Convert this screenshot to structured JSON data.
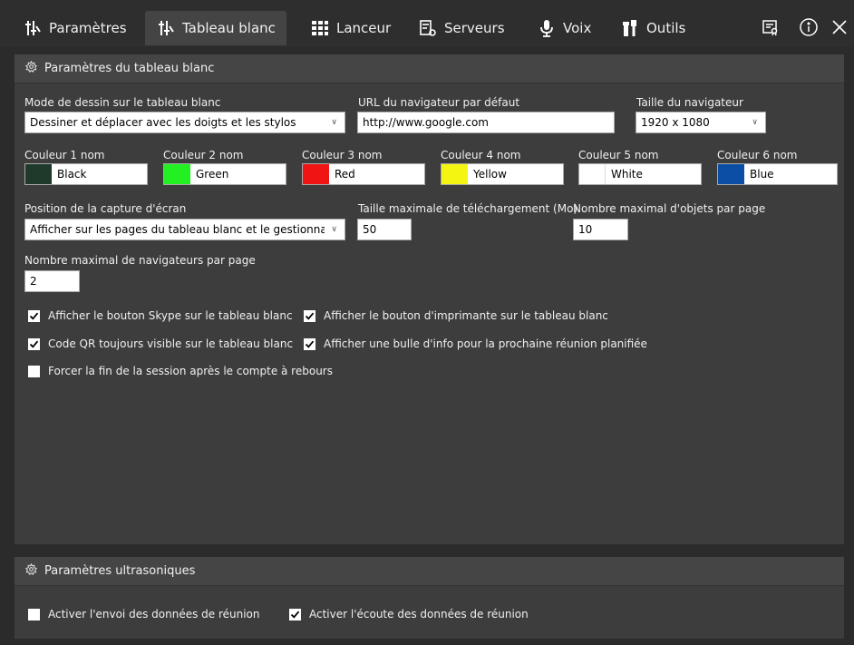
{
  "tabs": [
    {
      "label": "Paramètres",
      "icon": "settings-sliders-icon",
      "active": false
    },
    {
      "label": "Tableau blanc",
      "icon": "whiteboard-sliders-icon",
      "active": true
    },
    {
      "label": "Lanceur",
      "icon": "grid-icon",
      "active": false
    },
    {
      "label": "Serveurs",
      "icon": "server-settings-icon",
      "active": false
    },
    {
      "label": "Voix",
      "icon": "microphone-icon",
      "active": false
    },
    {
      "label": "Outils",
      "icon": "tools-icon",
      "active": false
    }
  ],
  "top_icons": [
    "license-icon",
    "info-icon",
    "close-icon"
  ],
  "whiteboard": {
    "title": "Paramètres du tableau blanc",
    "draw_mode": {
      "label": "Mode de dessin sur le tableau blanc",
      "value": "Dessiner et déplacer avec les doigts et les stylos"
    },
    "browser_url": {
      "label": "URL du navigateur par défaut",
      "value": "http://www.google.com"
    },
    "browser_size": {
      "label": "Taille du navigateur",
      "value": "1920 x 1080"
    },
    "colors": [
      {
        "label": "Couleur 1 nom",
        "name": "Black",
        "swatch": "#1f3a2a"
      },
      {
        "label": "Couleur 2 nom",
        "name": "Green",
        "swatch": "#22f022"
      },
      {
        "label": "Couleur 3 nom",
        "name": "Red",
        "swatch": "#f01414"
      },
      {
        "label": "Couleur 4 nom",
        "name": "Yellow",
        "swatch": "#f5f512"
      },
      {
        "label": "Couleur 5 nom",
        "name": "White",
        "swatch": "#ffffff"
      },
      {
        "label": "Couleur 6 nom",
        "name": "Blue",
        "swatch": "#0a4fa5"
      }
    ],
    "screenshot_position": {
      "label": "Position de la capture d'écran",
      "value": "Afficher sur les pages du tableau blanc et le gestionnai"
    },
    "max_upload": {
      "label": "Taille maximale de téléchargement (Mo)",
      "value": "50"
    },
    "max_objects": {
      "label": "Nombre maximal d'objets par page",
      "value": "10"
    },
    "max_browsers": {
      "label": "Nombre maximal de navigateurs par page",
      "value": "2"
    },
    "checkboxes": [
      {
        "label": "Afficher le bouton Skype sur le tableau blanc",
        "checked": true
      },
      {
        "label": "Afficher le bouton d'imprimante sur le tableau blanc",
        "checked": true
      },
      {
        "label": "Code QR toujours visible sur le tableau blanc",
        "checked": true
      },
      {
        "label": "Afficher une bulle d'info pour la prochaine réunion planifiée",
        "checked": true
      },
      {
        "label": "Forcer la fin de la session après le compte à rebours",
        "checked": false
      }
    ]
  },
  "ultrasonic": {
    "title": "Paramètres ultrasoniques",
    "checkboxes": [
      {
        "label": "Activer l'envoi des données de réunion",
        "checked": false
      },
      {
        "label": "Activer l'écoute des données de réunion",
        "checked": true
      }
    ]
  }
}
